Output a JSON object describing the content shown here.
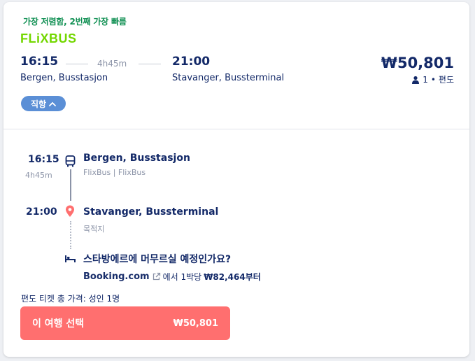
{
  "badge": "가장 저렴함, 2번째 가장 빠름",
  "carrier_logo": "FLiXBUS",
  "summary": {
    "depart_time": "16:15",
    "depart_place": "Bergen, Busstasjon",
    "duration": "4h45m",
    "arrive_time": "21:00",
    "arrive_place": "Stavanger, Bussterminal",
    "price": "₩50,801",
    "passengers": "1",
    "trip_type": "편도"
  },
  "toggle_label": "직항",
  "timeline": {
    "depart_time": "16:15",
    "duration": "4h45m",
    "depart_stop": "Bergen, Busstasjon",
    "operator": "FlixBus | FlixBus",
    "arrive_time": "21:00",
    "arrive_stop": "Stavanger, Bussterminal",
    "arrive_note": "목적지"
  },
  "hotel": {
    "question": "스타방에르에 머무르실 예정인가요?",
    "provider": "Booking.com",
    "offer_text": "에서 1박당",
    "offer_price": "₩82,464부터"
  },
  "total_label": "편도 티켓 총 가격: 성인 1명",
  "cta": {
    "label": "이 여행 선택",
    "price": "₩50,801"
  },
  "colors": {
    "brand_green": "#73d700",
    "navy": "#132968",
    "cta": "#ff6f6f",
    "pill": "#5b8fd6",
    "badge_green": "#0f8f52"
  }
}
